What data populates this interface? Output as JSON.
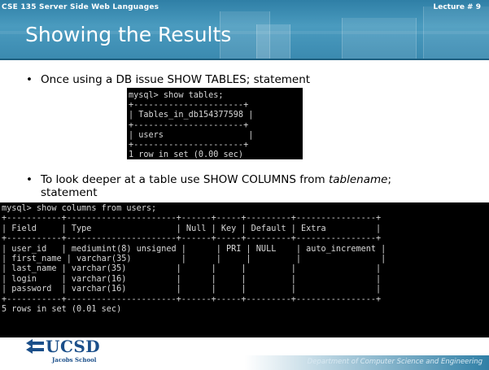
{
  "header": {
    "course": "CSE 135   Server Side Web Languages",
    "lecture": "Lecture # 9",
    "title": "Showing the Results"
  },
  "bullets": [
    {
      "dot": "•",
      "text": "Once using a DB issue SHOW TABLES; statement"
    },
    {
      "dot": "•",
      "text_pre": "To look deeper at a table use SHOW COLUMNS from ",
      "text_italic": "tablename",
      "text_post": ";",
      "text_line2": "statement"
    }
  ],
  "terminal1": {
    "lines": [
      "mysql> show tables;",
      "+----------------------+",
      "| Tables_in_db154377598 |",
      "+----------------------+",
      "| users                 |",
      "+----------------------+",
      "1 row in set (0.00 sec)"
    ]
  },
  "terminal2": {
    "lines": [
      "mysql> show columns from users;",
      "+-----------+----------------------+------+-----+---------+----------------+",
      "| Field     | Type                 | Null | Key | Default | Extra          |",
      "+-----------+----------------------+------+-----+---------+----------------+",
      "| user_id   | mediumint(8) unsigned |      | PRI | NULL    | auto_increment |",
      "| first_name | varchar(35)          |      |     |         |                |",
      "| last_name | varchar(35)          |      |     |         |                |",
      "| login     | varchar(16)          |      |     |         |                |",
      "| password  | varchar(16)          |      |     |         |                |",
      "+-----------+----------------------+------+-----+---------+----------------+",
      "5 rows in set (0.01 sec)"
    ]
  },
  "logo": {
    "name": "UCSD",
    "sub": "Jacobs School"
  },
  "footer": {
    "department": "Department of Computer Science and Engineering"
  },
  "colors": {
    "header": "#3b8ab0",
    "title_text": "#ffffff",
    "terminal_bg": "#000000",
    "logo": "#1b4f8a"
  }
}
